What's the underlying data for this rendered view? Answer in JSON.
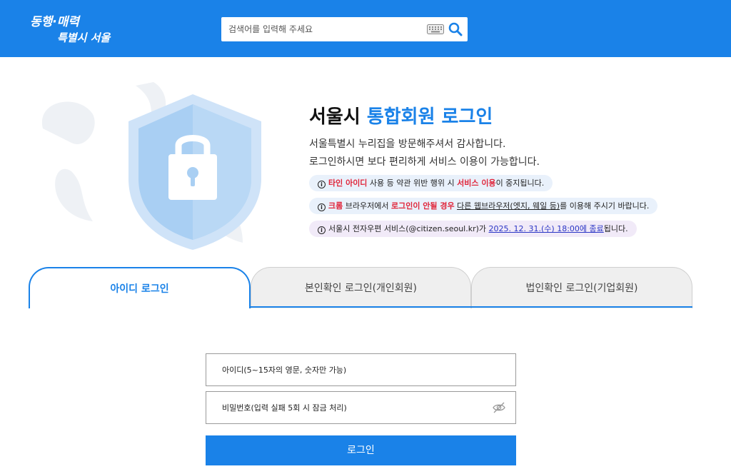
{
  "header": {
    "logo_text": "동행·매력 특별시 서울",
    "search_placeholder": "검색어를 입력해 주세요",
    "keyboard_icon": "keyboard-icon",
    "search_icon": "search-icon",
    "brand_color": "#1a82e8"
  },
  "hero": {
    "title_prefix": "서울시 ",
    "title_accent": "통합회원 로그인",
    "desc_line1": "서울특별시 누리집을 방문해주셔서 감사합니다.",
    "desc_line2": "로그인하시면 보다 편리하게 서비스 이용이 가능합니다.",
    "illustration_icon": "shield-lock-icon"
  },
  "notices": [
    {
      "parts": [
        "타인 아이디",
        " 사용 등 약관 위반 행위 시 ",
        "서비스 이용",
        "이 중지됩니다."
      ]
    },
    {
      "parts": [
        "크롬",
        " 브라우저에서 ",
        "로그인이 안될 경우",
        " ",
        "다른 웹브라우저(엣지, 웨일 등)",
        "를 이용해 주시기 바랍니다."
      ]
    },
    {
      "parts": [
        "서울시 전자우편 서비스(@citizen.seoul.kr)가 ",
        "2025. 12. 31.(수) 18:00에 종료",
        "됩니다."
      ]
    }
  ],
  "tabs": [
    {
      "label": "아이디 로그인",
      "active": true
    },
    {
      "label": "본인확인 로그인(개인회원)",
      "active": false
    },
    {
      "label": "법인확인 로그인(기업회원)",
      "active": false
    }
  ],
  "form": {
    "id_placeholder": "아이디(5~15자의 영문, 숫자만 가능)",
    "pw_placeholder": "비밀번호(입력 실패 5회 시 잠금 처리)",
    "pw_toggle_icon": "eye-off-icon",
    "login_label": "로그인"
  }
}
